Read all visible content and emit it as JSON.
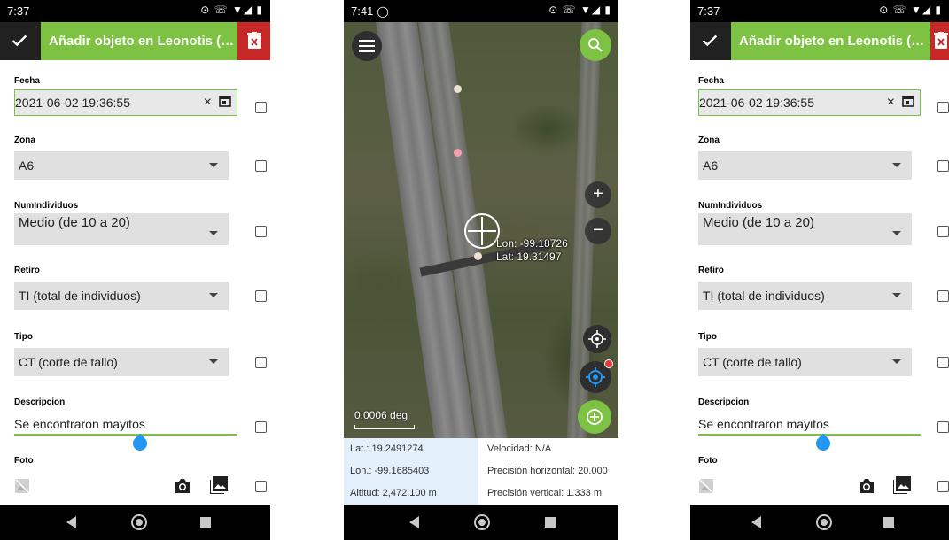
{
  "screens": [
    {
      "time": "7:37",
      "title": "Añadir objeto en Leonotis (offlin...",
      "fecha_label": "Fecha",
      "fecha_value": "2021-06-02 19:36:55",
      "clear_glyph": "×",
      "zona_label": "Zona",
      "zona_value": "A6",
      "num_label": "NumIndividuos",
      "num_value": "Medio (de 10 a 20)",
      "retiro_label": "Retiro",
      "retiro_value": "TI (total de individuos)",
      "tipo_label": "Tipo",
      "tipo_value": "CT (corte de tallo)",
      "desc_label": "Descripcion",
      "desc_value": "Se encontraron mayitos",
      "foto_label": "Foto"
    },
    {
      "time": "7:41",
      "lon_overlay": "Lon: -99.18726",
      "lat_overlay": "Lat: 19.31497",
      "scale_text": "0.0006 deg",
      "lat": "Lat.: 19.2491274",
      "lon": "Lon.: -99.1685403",
      "alt": "Altitud: 2,472.100 m",
      "vel": "Velocidad: N/A",
      "prec_h": "Precisión horizontal: 20.000",
      "prec_v": "Precisión vertical: 1.333 m",
      "plus": "+",
      "minus": "−"
    },
    {
      "time": "7:37",
      "title": "Añadir objeto en Leonotis (offlin...",
      "fecha_label": "Fecha",
      "fecha_value": "2021-06-02 19:36:55",
      "clear_glyph": "×",
      "zona_label": "Zona",
      "zona_value": "A6",
      "num_label": "NumIndividuos",
      "num_value": "Medio (de 10 a 20)",
      "retiro_label": "Retiro",
      "retiro_value": "TI (total de individuos)",
      "tipo_label": "Tipo",
      "tipo_value": "CT (corte de tallo)",
      "desc_label": "Descripcion",
      "desc_value": "Se encontraron mayitos",
      "foto_label": "Foto"
    }
  ],
  "colors": {
    "accent_green": "#7dc242",
    "delete_red": "#c62828",
    "toolbar_dark": "#212121",
    "handle_blue": "#2196f3",
    "location_blue": "#2196f3"
  },
  "icons": [
    "check-icon",
    "delete-icon",
    "calendar-icon",
    "dropdown-arrow-icon",
    "camera-icon",
    "gallery-icon",
    "image-placeholder-icon",
    "menu-icon",
    "search-icon",
    "location-target-icon",
    "gps-icon",
    "add-icon",
    "back-icon",
    "home-icon",
    "recents-icon"
  ]
}
